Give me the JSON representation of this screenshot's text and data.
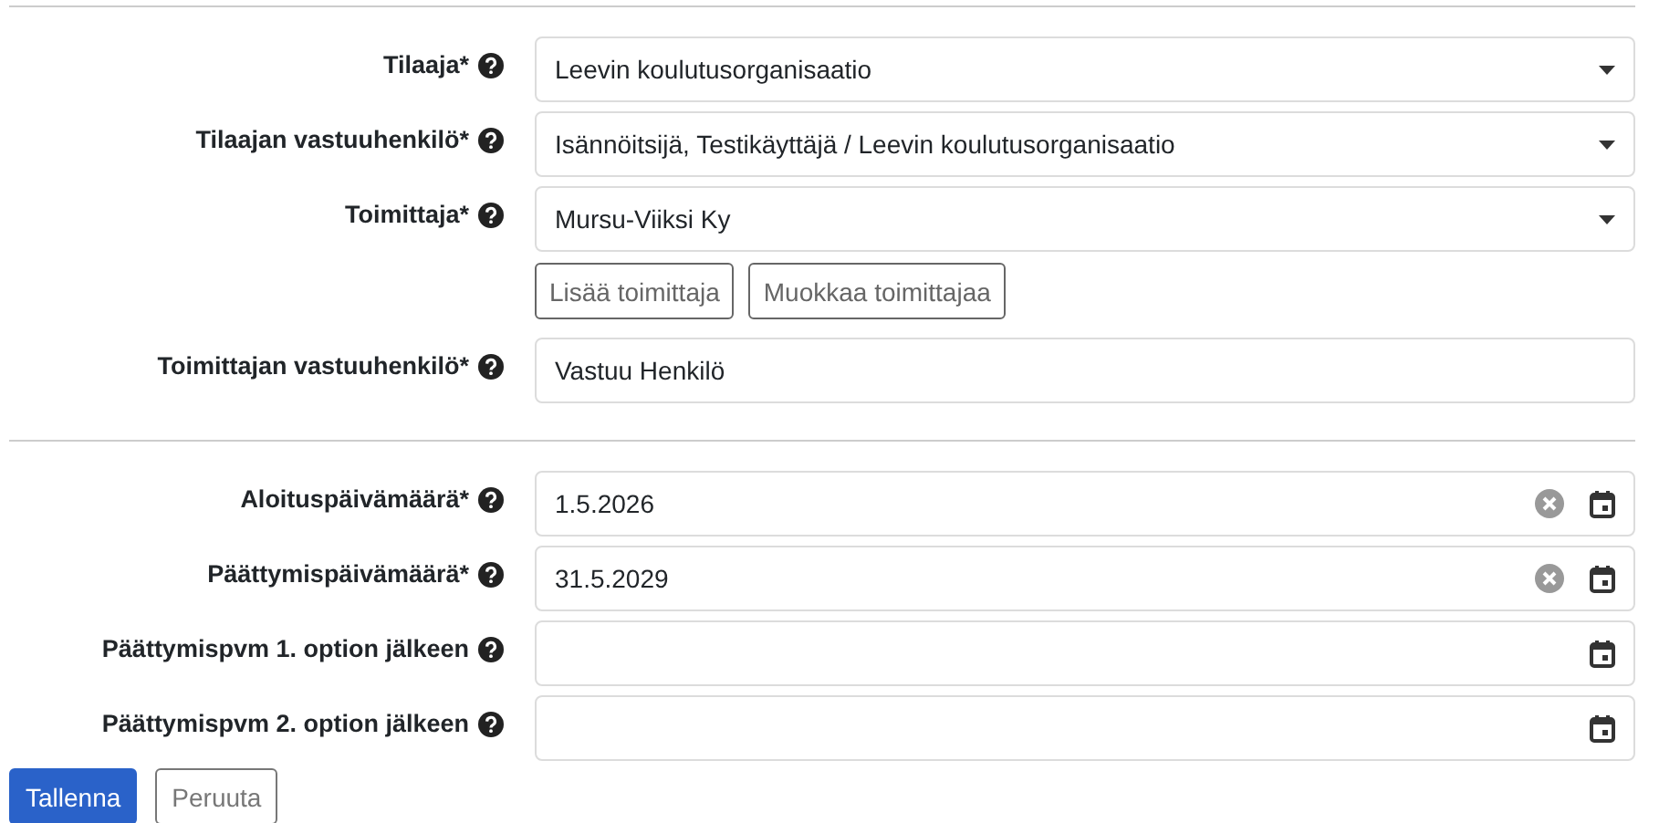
{
  "sections": [
    {
      "fields": [
        {
          "kind": "select",
          "label": "Tilaaja*",
          "value": "Leevin koulutusorganisaatio"
        },
        {
          "kind": "select",
          "label": "Tilaajan vastuuhenkilö*",
          "value": "Isännöitsijä, Testikäyttäjä / Leevin koulutusorganisaatio"
        },
        {
          "kind": "select",
          "label": "Toimittaja*",
          "value": "Mursu-Viiksi Ky",
          "buttons": [
            "Lisää toimittaja",
            "Muokkaa toimittajaa"
          ]
        },
        {
          "kind": "text",
          "label": "Toimittajan vastuuhenkilö*",
          "value": "Vastuu Henkilö"
        }
      ]
    },
    {
      "fields": [
        {
          "kind": "date",
          "label": "Aloituspäivämäärä*",
          "value": "1.5.2026",
          "clearable": true
        },
        {
          "kind": "date",
          "label": "Päättymispäivämäärä*",
          "value": "31.5.2029",
          "clearable": true
        },
        {
          "kind": "date",
          "label": "Päättymispvm 1. option jälkeen",
          "clearable": false
        },
        {
          "kind": "date",
          "label": "Päättymispvm 2. option jälkeen",
          "clearable": false
        }
      ]
    }
  ],
  "actions": [
    {
      "label": "Tallenna",
      "kind": "primary"
    },
    {
      "label": "Peruuta",
      "kind": "secondary"
    }
  ]
}
